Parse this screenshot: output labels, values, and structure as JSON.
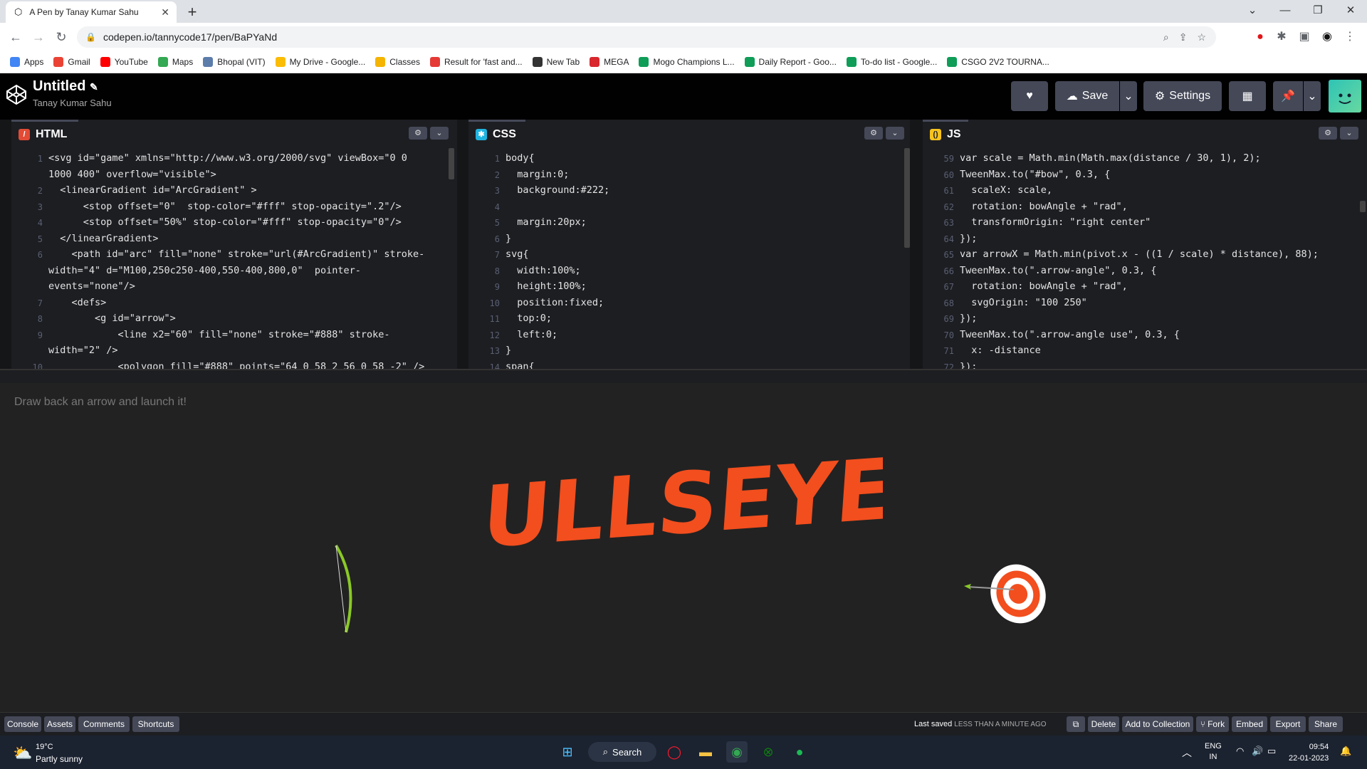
{
  "browser": {
    "tab_title": "A Pen by Tanay Kumar Sahu",
    "url": "codepen.io/tannycode17/pen/BaPYaNd",
    "bookmarks": [
      {
        "label": "Apps",
        "color": "#4285f4"
      },
      {
        "label": "Gmail",
        "color": "#ea4335"
      },
      {
        "label": "YouTube",
        "color": "#ff0000"
      },
      {
        "label": "Maps",
        "color": "#34a853"
      },
      {
        "label": "Bhopal (VIT)",
        "color": "#5c7caa"
      },
      {
        "label": "My Drive - Google...",
        "color": "#fbbc04"
      },
      {
        "label": "Classes",
        "color": "#f4b400"
      },
      {
        "label": "Result for 'fast and...",
        "color": "#e53935"
      },
      {
        "label": "New Tab",
        "color": "#333333"
      },
      {
        "label": "MEGA",
        "color": "#d9272e"
      },
      {
        "label": "Mogo Champions L...",
        "color": "#0f9d58"
      },
      {
        "label": "Daily Report - Goo...",
        "color": "#0f9d58"
      },
      {
        "label": "To-do list - Google...",
        "color": "#0f9d58"
      },
      {
        "label": "CSGO 2V2 TOURNA...",
        "color": "#0f9d58"
      }
    ]
  },
  "codepen": {
    "title": "Untitled",
    "author": "Tanay Kumar Sahu",
    "buttons": {
      "save": "Save",
      "settings": "Settings"
    }
  },
  "editors": {
    "html": {
      "label": "HTML",
      "lines": [
        {
          "n": "1",
          "code": "<svg id=\"game\" xmlns=\"http://www.w3.org/2000/svg\" viewBox=\"0 0"
        },
        {
          "n": "",
          "code": "1000 400\" overflow=\"visible\">"
        },
        {
          "n": "2",
          "code": "  <linearGradient id=\"ArcGradient\" >"
        },
        {
          "n": "3",
          "code": "      <stop offset=\"0\"  stop-color=\"#fff\" stop-opacity=\".2\"/>"
        },
        {
          "n": "4",
          "code": "      <stop offset=\"50%\" stop-color=\"#fff\" stop-opacity=\"0\"/>"
        },
        {
          "n": "5",
          "code": "  </linearGradient>"
        },
        {
          "n": "6",
          "code": "    <path id=\"arc\" fill=\"none\" stroke=\"url(#ArcGradient)\" stroke-"
        },
        {
          "n": "",
          "code": "width=\"4\" d=\"M100,250c250-400,550-400,800,0\"  pointer-"
        },
        {
          "n": "",
          "code": "events=\"none\"/>"
        },
        {
          "n": "7",
          "code": "    <defs>"
        },
        {
          "n": "8",
          "code": "        <g id=\"arrow\">"
        },
        {
          "n": "9",
          "code": "            <line x2=\"60\" fill=\"none\" stroke=\"#888\" stroke-"
        },
        {
          "n": "",
          "code": "width=\"2\" />"
        },
        {
          "n": "10",
          "code": "            <polygon fill=\"#888\" points=\"64 0 58 2 56 0 58 -2\" />"
        }
      ]
    },
    "css": {
      "label": "CSS",
      "lines": [
        {
          "n": "1",
          "code": "body{"
        },
        {
          "n": "2",
          "code": "  margin:0;"
        },
        {
          "n": "3",
          "code": "  background:#222;"
        },
        {
          "n": "4",
          "code": ""
        },
        {
          "n": "5",
          "code": "  margin:20px;"
        },
        {
          "n": "6",
          "code": "}"
        },
        {
          "n": "7",
          "code": "svg{"
        },
        {
          "n": "8",
          "code": "  width:100%;"
        },
        {
          "n": "9",
          "code": "  height:100%;"
        },
        {
          "n": "10",
          "code": "  position:fixed;"
        },
        {
          "n": "11",
          "code": "  top:0;"
        },
        {
          "n": "12",
          "code": "  left:0;"
        },
        {
          "n": "13",
          "code": "}"
        },
        {
          "n": "14",
          "code": "span{"
        }
      ]
    },
    "js": {
      "label": "JS",
      "lines": [
        {
          "n": "59",
          "code": "var scale = Math.min(Math.max(distance / 30, 1), 2);"
        },
        {
          "n": "60",
          "code": "TweenMax.to(\"#bow\", 0.3, {"
        },
        {
          "n": "61",
          "code": "  scaleX: scale,"
        },
        {
          "n": "62",
          "code": "  rotation: bowAngle + \"rad\","
        },
        {
          "n": "63",
          "code": "  transformOrigin: \"right center\""
        },
        {
          "n": "64",
          "code": "});"
        },
        {
          "n": "65",
          "code": "var arrowX = Math.min(pivot.x - ((1 / scale) * distance), 88);"
        },
        {
          "n": "66",
          "code": "TweenMax.to(\".arrow-angle\", 0.3, {"
        },
        {
          "n": "67",
          "code": "  rotation: bowAngle + \"rad\","
        },
        {
          "n": "68",
          "code": "  svgOrigin: \"100 250\""
        },
        {
          "n": "69",
          "code": "});"
        },
        {
          "n": "70",
          "code": "TweenMax.to(\".arrow-angle use\", 0.3, {"
        },
        {
          "n": "71",
          "code": "  x: -distance"
        },
        {
          "n": "72",
          "code": "});"
        }
      ]
    }
  },
  "preview": {
    "instruction": "Draw back an arrow and launch it!",
    "banner": "BULLSEYE!"
  },
  "footer": {
    "left_buttons": [
      "Console",
      "Assets",
      "Comments",
      "Shortcuts"
    ],
    "last_saved_prefix": "Last saved",
    "last_saved_value": "LESS THAN A MINUTE AGO",
    "right_buttons": [
      "Delete",
      "Add to Collection",
      "Fork",
      "Embed",
      "Export",
      "Share"
    ]
  },
  "taskbar": {
    "temp": "19°C",
    "weather": "Partly sunny",
    "search": "Search",
    "lang": "ENG",
    "region": "IN",
    "time": "09:54",
    "date": "22-01-2023"
  }
}
